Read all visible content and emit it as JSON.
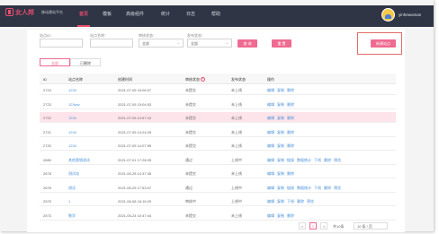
{
  "header": {
    "brand": "女人邦",
    "brand_sub": "移动建站平台",
    "nav": [
      "首页",
      "模板",
      "高级组件",
      "统计",
      "日志",
      "帮助"
    ],
    "active_nav": "首页",
    "username": "yinhewoman"
  },
  "filters": {
    "site_id_label": "站点ID：",
    "site_name_label": "站点名称：",
    "audit_status_label": "审核状态：",
    "release_status_label": "发布状态：",
    "audit_status_value": "全部",
    "release_status_value": "全部",
    "query_btn": "查 询",
    "reset_btn": "重 置",
    "new_site_btn": "新建站点"
  },
  "tabs": [
    {
      "label": "全部"
    },
    {
      "label": "已删除"
    }
  ],
  "table": {
    "headers": [
      "ID",
      "站点名称",
      "创建时间",
      "审核状态",
      "发布状态",
      "操作"
    ],
    "rows": [
      {
        "id": "2724",
        "name": "1234",
        "time": "2021-07-05 15:06:07",
        "audit": "未提交",
        "release": "未上线",
        "ops": [
          "编辑",
          "复制",
          "删除"
        ]
      },
      {
        "id": "2723",
        "name": "123ww",
        "time": "2021-07-05 15:04:53",
        "audit": "未提交",
        "release": "未上线",
        "ops": [
          "编辑",
          "复制",
          "删除"
        ]
      },
      {
        "id": "2722",
        "name": "1234",
        "time": "2021-07-05 14:57:10",
        "audit": "未提交",
        "release": "未上线",
        "ops": [
          "编辑",
          "复制",
          "删除"
        ]
      },
      {
        "id": "2721",
        "name": "1234",
        "time": "2021-07-05 14:24:25",
        "audit": "未提交",
        "release": "未上线",
        "ops": [
          "编辑",
          "复制",
          "删除"
        ]
      },
      {
        "id": "2720",
        "name": "1234",
        "time": "2021-07-05 14:07:55",
        "audit": "未提交",
        "release": "未上线",
        "ops": [
          "编辑",
          "复制",
          "删除"
        ]
      },
      {
        "id": "2680",
        "name": "其他营销测试",
        "time": "2021-07-01 17:28:25",
        "audit": "通过",
        "release": "上线中",
        "ops": [
          "编辑",
          "复制",
          "链接",
          "数据统计",
          "下线",
          "删除",
          "预览"
        ]
      },
      {
        "id": "2678",
        "name": "测试站",
        "time": "2021-06-28 14:37:45",
        "audit": "未提交",
        "release": "未上线",
        "ops": [
          "编辑",
          "复制",
          "删除"
        ]
      },
      {
        "id": "2676",
        "name": "测试",
        "time": "2021-06-25 17:53:47",
        "audit": "通过",
        "release": "上线中",
        "ops": [
          "编辑",
          "复制",
          "链接",
          "数据统计",
          "下线",
          "删除",
          "预览"
        ]
      },
      {
        "id": "2575",
        "name": "1",
        "time": "2021-06-08 16:16:29",
        "audit": "审核中",
        "release": "上线中",
        "ops": [
          "编辑",
          "复制",
          "下线",
          "删除",
          "预览"
        ]
      },
      {
        "id": "2573",
        "name": "数学",
        "time": "2021-05-24 10:47:44",
        "audit": "未提交",
        "release": "未上线",
        "ops": [
          "编辑",
          "复制",
          "删除"
        ]
      }
    ]
  },
  "pagination": {
    "prev": "<",
    "current": "1",
    "next": ">",
    "total": "共10条",
    "page_size": "10 条 / 页"
  },
  "colors": {
    "accent": "#ef6b91",
    "link": "#4a90d9",
    "topbar": "#2f3545",
    "highlight_row": "#fde4ea"
  }
}
